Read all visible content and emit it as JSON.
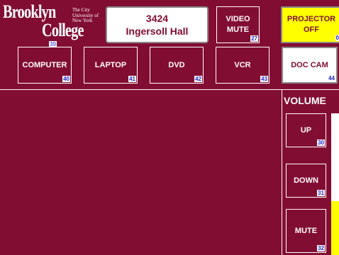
{
  "logo": {
    "line1": "Brooklyn",
    "line2": "College",
    "small": "The City University of New York",
    "num": "39"
  },
  "room": {
    "number": "3424",
    "name": "Ingersoll Hall"
  },
  "top_buttons": [
    {
      "label": "VIDEO MUTE",
      "num": "27"
    },
    {
      "label": "PROJECTOR OFF",
      "num": "0"
    }
  ],
  "sources": [
    {
      "label": "COMPUTER",
      "num": "40"
    },
    {
      "label": "LAPTOP",
      "num": "41"
    },
    {
      "label": "DVD",
      "num": "42"
    },
    {
      "label": "VCR",
      "num": "43"
    },
    {
      "label": "DOC CAM",
      "num": "44"
    }
  ],
  "volume": {
    "title": "VOLUME",
    "up": {
      "label": "UP",
      "num": "30"
    },
    "down": {
      "label": "DOWN",
      "num": "31"
    },
    "mute": {
      "label": "MUTE",
      "num": "32"
    },
    "level_percent": 38
  },
  "colors": {
    "background": "#820d33",
    "active": "#ffffff",
    "projector": "#ffff00",
    "number_text": "#2222cc"
  }
}
